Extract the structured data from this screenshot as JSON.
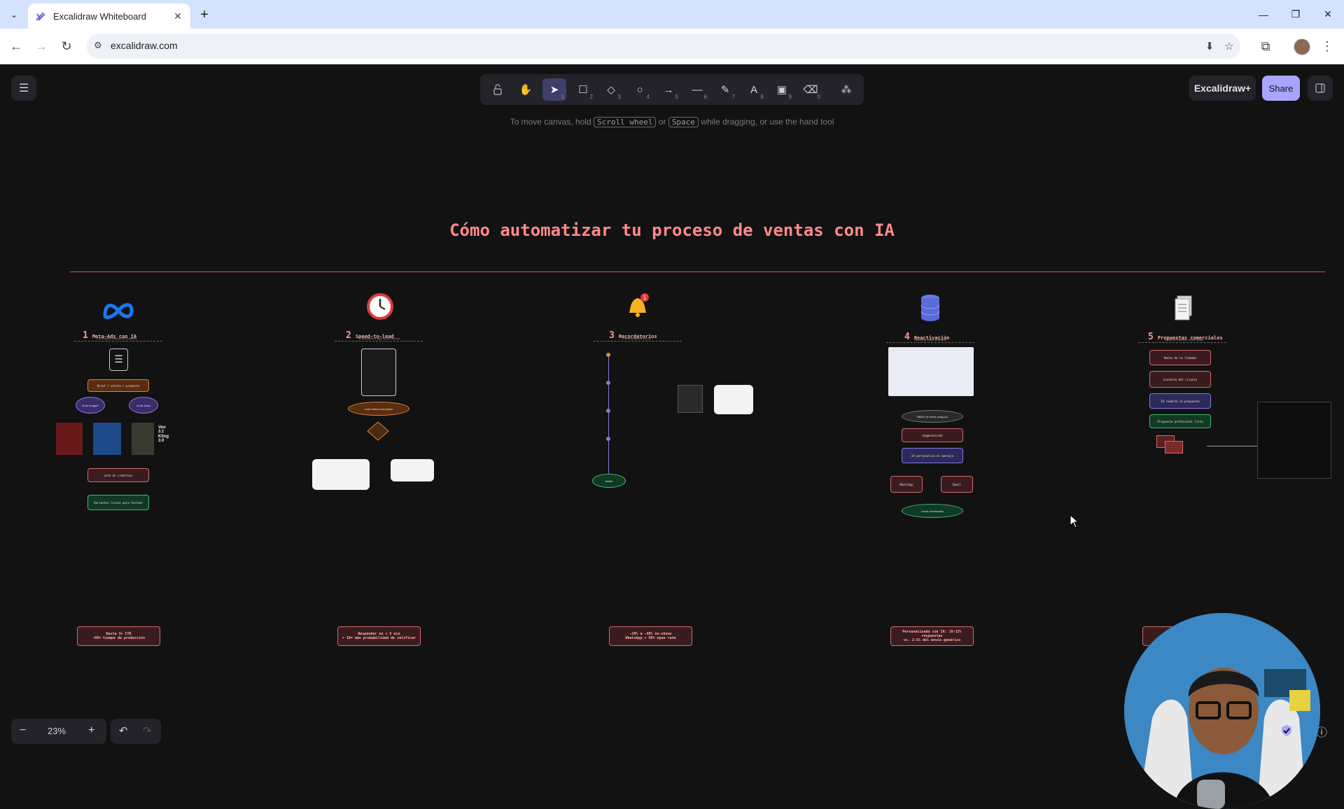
{
  "browser": {
    "tab_title": "Excalidraw Whiteboard",
    "url": "excalidraw.com"
  },
  "app": {
    "hint_pre": "To move canvas, hold",
    "hint_key1": "Scroll wheel",
    "hint_mid": "or",
    "hint_key2": "Space",
    "hint_post": "while dragging, or use the hand tool",
    "excalidraw_plus": "Excalidraw+",
    "share": "Share",
    "zoom": "23%",
    "tools": [
      {
        "name": "lock-tool",
        "key": ""
      },
      {
        "name": "hand-tool",
        "key": ""
      },
      {
        "name": "selection-tool",
        "key": "1"
      },
      {
        "name": "rectangle-tool",
        "key": "2"
      },
      {
        "name": "diamond-tool",
        "key": "3"
      },
      {
        "name": "ellipse-tool",
        "key": "4"
      },
      {
        "name": "arrow-tool",
        "key": "5"
      },
      {
        "name": "line-tool",
        "key": "6"
      },
      {
        "name": "draw-tool",
        "key": "7"
      },
      {
        "name": "text-tool",
        "key": "8"
      },
      {
        "name": "image-tool",
        "key": "9"
      },
      {
        "name": "eraser-tool",
        "key": "0"
      },
      {
        "name": "extra-tools",
        "key": ""
      }
    ]
  },
  "board": {
    "title": "Cómo automatizar tu proceso de ventas con IA",
    "sections": [
      {
        "num": "1",
        "label": "Meta-Ads con IA",
        "sub": "Generación masiva de creativos"
      },
      {
        "num": "2",
        "label": "Speed-to-lead",
        "sub": "Calificación y agenda al instante"
      },
      {
        "num": "3",
        "label": "Recordatorios",
        "sub": "Personalizados con IA"
      },
      {
        "num": "4",
        "label": "Reactivación",
        "sub": "Recupera leads dormidos"
      },
      {
        "num": "5",
        "label": "Propuestas comerciales",
        "sub": "Listas en minutos, no en horas"
      }
    ],
    "meta_models": [
      "Veo 3.1",
      "Kling 3.0"
    ],
    "bottom": [
      {
        "l1": "Hasta 3× CTR",
        "l2": "-80% tiempo de producción"
      },
      {
        "l1": "Responder en < 5 min",
        "l2": "= 10× más probabilidad de calificar"
      },
      {
        "l1": "-20% a -40% no-shows",
        "l2": "WhatsApp > 98% open rate"
      },
      {
        "l1": "Personalizado con IA: 10-15% respuestas",
        "l2": "vs. 2-5% del envío genérico"
      },
      {
        "l1": "",
        "l2": ""
      }
    ]
  }
}
